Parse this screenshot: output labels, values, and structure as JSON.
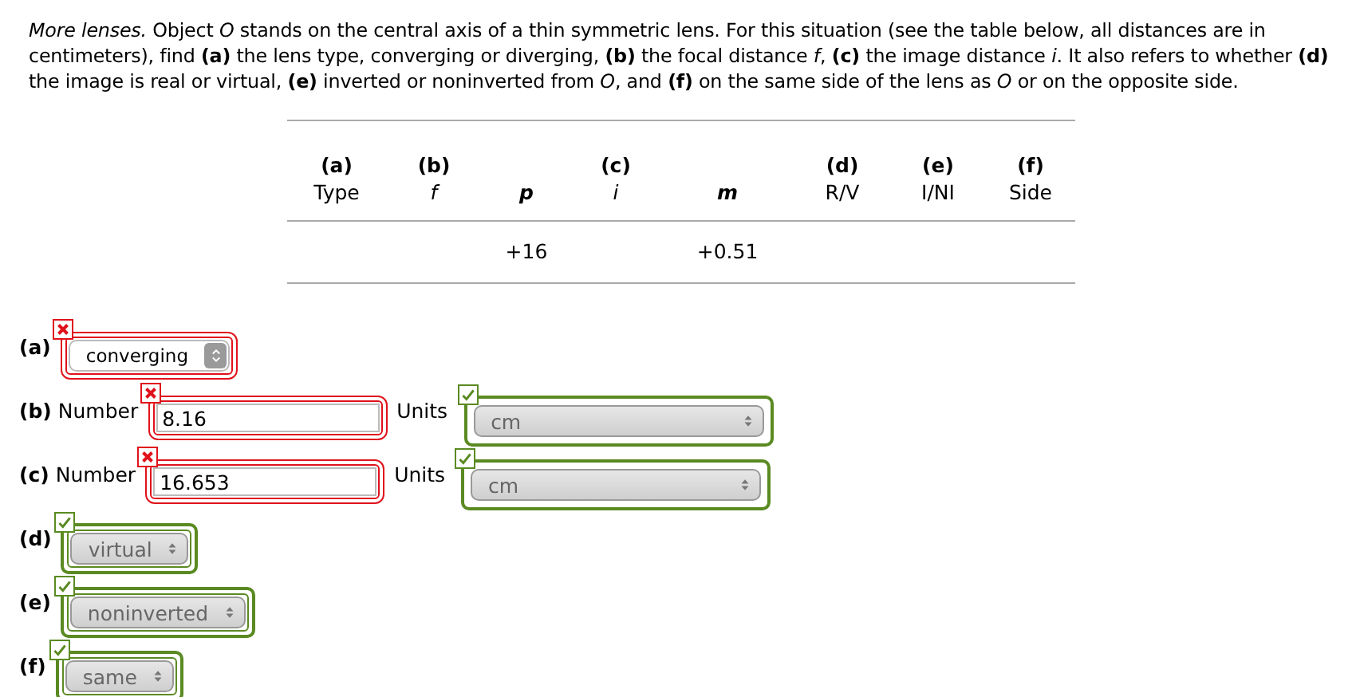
{
  "intro": "*More lenses.* Object *O* stands on the central axis of a thin symmetric lens. For this situation (see the table below, all distances are in centimeters), find **(a)** the lens type, converging or diverging, **(b)** the focal distance *f*, **(c)** the image distance *i*. It also refers to whether **(d)** the image is real or virtual, **(e)** inverted or noninverted from *O*, and **(f)** on the same side of the lens as *O* or on the opposite side.",
  "table": {
    "columns": [
      {
        "letter": "(a)",
        "label": "Type",
        "kind": "word"
      },
      {
        "letter": "(b)",
        "label": "f",
        "kind": "variable"
      },
      {
        "label": "p",
        "kind": "given",
        "value": "+16"
      },
      {
        "letter": "(c)",
        "label": "i",
        "kind": "variable"
      },
      {
        "label": "m",
        "kind": "given",
        "value": "+0.51"
      },
      {
        "letter": "(d)",
        "label": "R/V",
        "kind": "word"
      },
      {
        "letter": "(e)",
        "label": "I/NI",
        "kind": "word"
      },
      {
        "letter": "(f)",
        "label": "Side",
        "kind": "word"
      }
    ]
  },
  "answers": [
    {
      "letter": "(a)",
      "kind": "select",
      "value": "converging",
      "correct": false
    },
    {
      "letter": "(b)",
      "prompt": "Number",
      "kind": "number",
      "value": "8.16",
      "correct": false,
      "units_label": "Units",
      "units": {
        "value": "cm",
        "correct": true
      }
    },
    {
      "letter": "(c)",
      "prompt": "Number",
      "kind": "number",
      "value": "16.653",
      "correct": false,
      "units_label": "Units",
      "units": {
        "value": "cm",
        "correct": true
      }
    },
    {
      "letter": "(d)",
      "kind": "select",
      "value": "virtual",
      "correct": true
    },
    {
      "letter": "(e)",
      "kind": "select",
      "value": "noninverted",
      "correct": true
    },
    {
      "letter": "(f)",
      "kind": "select",
      "value": "same",
      "correct": true
    }
  ]
}
